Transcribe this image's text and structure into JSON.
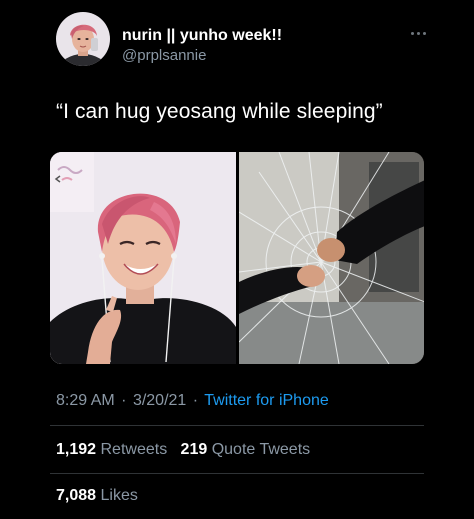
{
  "author": {
    "display_name": "nurin || yunho week!!",
    "handle": "@prplsannie"
  },
  "tweet": {
    "text": "“I can hug yeosang while sleeping”"
  },
  "meta": {
    "time": "8:29 AM",
    "separator": "·",
    "date": "3/20/21",
    "source": "Twitter for iPhone"
  },
  "stats": {
    "retweets_count": "1,192",
    "retweets_label": "Retweets",
    "quotes_count": "219",
    "quotes_label": "Quote Tweets",
    "likes_count": "7,088",
    "likes_label": "Likes"
  },
  "colors": {
    "background": "#000000",
    "text": "#ffffff",
    "muted": "#8b98a5",
    "link": "#1d9bf0",
    "divider": "#2f3336"
  },
  "icons": {
    "more": "more-options-icon"
  }
}
